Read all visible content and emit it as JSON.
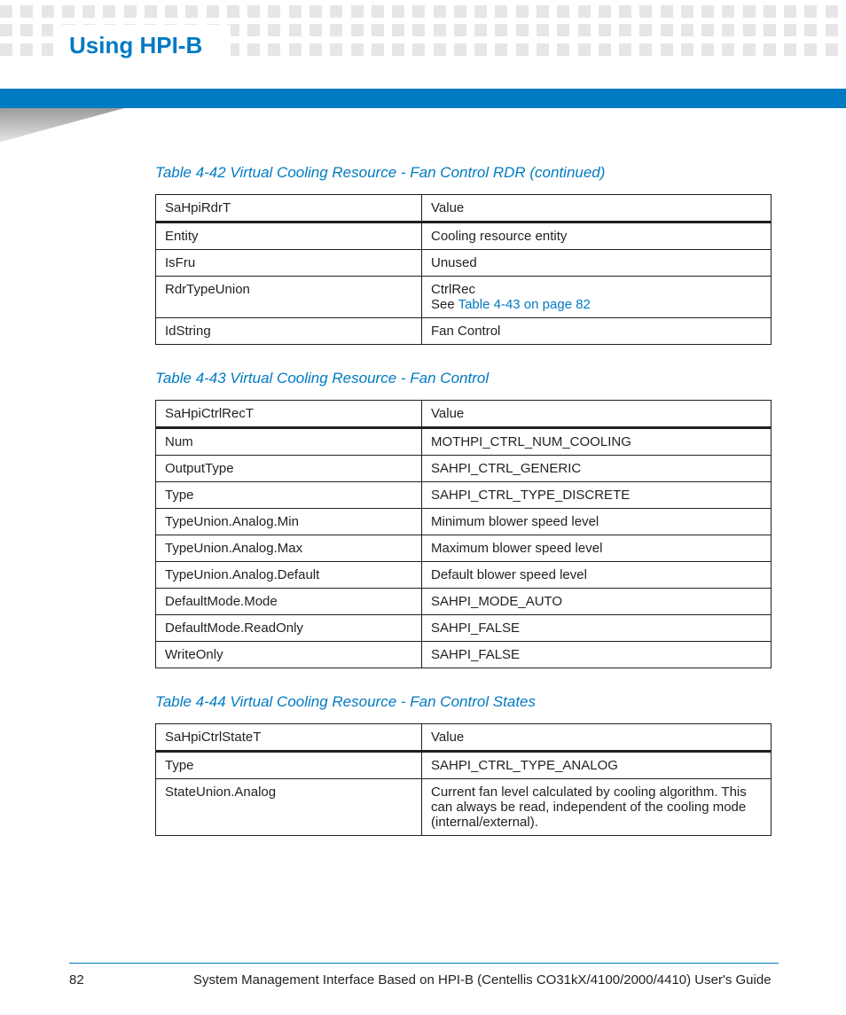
{
  "header": {
    "title": "Using HPI-B"
  },
  "section1": {
    "caption": "Table 4-42 Virtual Cooling Resource - Fan Control RDR (continued)",
    "rows": [
      {
        "c0": "SaHpiRdrT",
        "c1": "Value"
      },
      {
        "c0": "Entity",
        "c1": "Cooling resource entity"
      },
      {
        "c0": "IsFru",
        "c1": "Unused"
      },
      {
        "c0": "RdrTypeUnion",
        "c1_prefix": "CtrlRec",
        "c1_link": "Table 4-43 on page 82",
        "c1_see": "See "
      },
      {
        "c0": "IdString",
        "c1": "Fan Control"
      }
    ]
  },
  "section2": {
    "caption": "Table 4-43 Virtual Cooling Resource - Fan Control",
    "rows": [
      {
        "c0": "SaHpiCtrlRecT",
        "c1": "Value"
      },
      {
        "c0": "Num",
        "c1": "MOTHPI_CTRL_NUM_COOLING"
      },
      {
        "c0": "OutputType",
        "c1": "SAHPI_CTRL_GENERIC"
      },
      {
        "c0": "Type",
        "c1": "SAHPI_CTRL_TYPE_DISCRETE"
      },
      {
        "c0": "TypeUnion.Analog.Min",
        "c1": "Minimum blower speed level"
      },
      {
        "c0": "TypeUnion.Analog.Max",
        "c1": "Maximum blower speed level"
      },
      {
        "c0": "TypeUnion.Analog.Default",
        "c1": "Default blower speed level"
      },
      {
        "c0": "DefaultMode.Mode",
        "c1": "SAHPI_MODE_AUTO"
      },
      {
        "c0": "DefaultMode.ReadOnly",
        "c1": "SAHPI_FALSE"
      },
      {
        "c0": "WriteOnly",
        "c1": "SAHPI_FALSE"
      }
    ]
  },
  "section3": {
    "caption": "Table 4-44 Virtual Cooling Resource - Fan Control States",
    "rows": [
      {
        "c0": "SaHpiCtrlStateT",
        "c1": "Value"
      },
      {
        "c0": "Type",
        "c1": "SAHPI_CTRL_TYPE_ANALOG"
      },
      {
        "c0": "StateUnion.Analog",
        "c1": "Current fan level calculated by cooling algorithm. This can always be read, independent of the cooling mode (internal/external)."
      }
    ]
  },
  "footer": {
    "page": "82",
    "doc": "System Management Interface Based on HPI-B (Centellis CO31kX/4100/2000/4410) User's Guide"
  }
}
